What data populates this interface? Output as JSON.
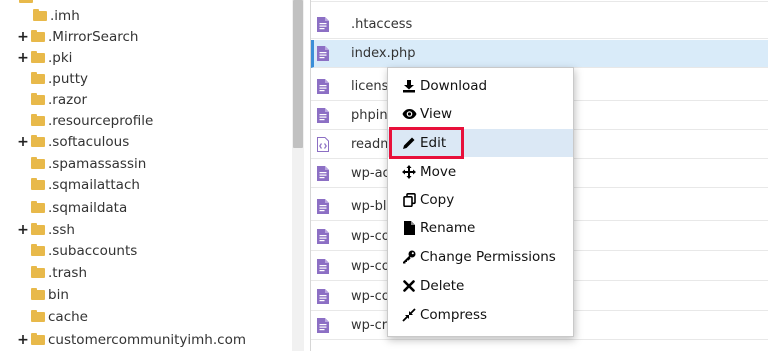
{
  "tree": {
    "items": [
      {
        "label": ".imh",
        "expand": ""
      },
      {
        "label": ".MirrorSearch",
        "expand": "+"
      },
      {
        "label": ".pki",
        "expand": "+"
      },
      {
        "label": ".putty",
        "expand": ""
      },
      {
        "label": ".razor",
        "expand": ""
      },
      {
        "label": ".resourceprofile",
        "expand": ""
      },
      {
        "label": ".softaculous",
        "expand": "+"
      },
      {
        "label": ".spamassassin",
        "expand": ""
      },
      {
        "label": ".sqmailattach",
        "expand": ""
      },
      {
        "label": ".sqmaildata",
        "expand": ""
      },
      {
        "label": ".ssh",
        "expand": "+"
      },
      {
        "label": ".subaccounts",
        "expand": ""
      },
      {
        "label": ".trash",
        "expand": ""
      },
      {
        "label": "bin",
        "expand": ""
      },
      {
        "label": "cache",
        "expand": ""
      },
      {
        "label": "customercommunityimh.com",
        "expand": "+"
      }
    ]
  },
  "files": {
    "rows": [
      {
        "name": ".htaccess",
        "icon": "text-file-icon"
      },
      {
        "name": "index.php",
        "icon": "text-file-icon",
        "selected": true
      },
      {
        "name": "license",
        "icon": "text-file-icon"
      },
      {
        "name": "phpinf",
        "icon": "text-file-icon"
      },
      {
        "name": "readm",
        "icon": "html-file-icon"
      },
      {
        "name": "wp-ac",
        "icon": "text-file-icon"
      },
      {
        "name": "wp-blo",
        "icon": "text-file-icon"
      },
      {
        "name": "wp-co",
        "icon": "text-file-icon"
      },
      {
        "name": "wp-co",
        "icon": "text-file-icon"
      },
      {
        "name": "wp-co",
        "icon": "text-file-icon"
      },
      {
        "name": "wp-cro",
        "icon": "text-file-icon"
      }
    ]
  },
  "context_menu": {
    "items": [
      {
        "label": "Download",
        "icon": "download-icon"
      },
      {
        "label": "View",
        "icon": "eye-icon"
      },
      {
        "label": "Edit",
        "icon": "pencil-icon",
        "hover": true
      },
      {
        "label": "Move",
        "icon": "move-arrows-icon"
      },
      {
        "label": "Copy",
        "icon": "copy-icon"
      },
      {
        "label": "Rename",
        "icon": "rename-file-icon"
      },
      {
        "label": "Change Permissions",
        "icon": "key-icon"
      },
      {
        "label": "Delete",
        "icon": "delete-x-icon"
      },
      {
        "label": "Compress",
        "icon": "compress-icon"
      }
    ]
  },
  "colors": {
    "folder": "#e8b94a",
    "file_icon": "#8c6fc4",
    "selected_row": "#d9ebf9",
    "menu_hover": "#dbe8f5",
    "highlight": "#e8103a"
  }
}
